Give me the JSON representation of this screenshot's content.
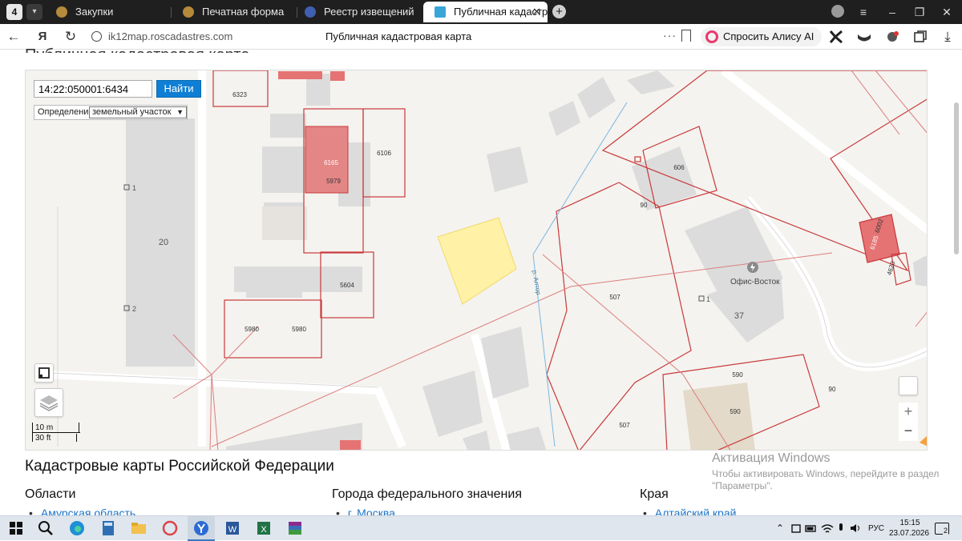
{
  "browser": {
    "tab_counter": "4",
    "tabs": [
      {
        "label": "Закупки"
      },
      {
        "label": "Печатная форма"
      },
      {
        "label": "Реестр извещений"
      },
      {
        "label": "Публичная кадастровая"
      }
    ],
    "address": {
      "url": "ik12map.roscadastres.com",
      "title": "Публичная кадастровая карта",
      "alice_label": "Спросить Алису AI"
    }
  },
  "map": {
    "search_value": "14:22:050001:6434",
    "find_label": "Найти",
    "definition_label": "Определение:",
    "definition_value": "земельный участок",
    "scale_metric": "10 m",
    "scale_imperial": "30 ft",
    "parcel_labels": [
      "6323",
      "6165",
      "5979",
      "6106",
      "606",
      "90",
      "5604",
      "5980",
      "5980",
      "507",
      "507",
      "590",
      "590",
      "90",
      "6002",
      "6185",
      "4620"
    ],
    "building_labels": [
      "20",
      "37"
    ],
    "entrance_labels": [
      "1",
      "2",
      "1"
    ],
    "poi_label": "Офис-Восток",
    "street_label": "р. Алтор",
    "colors": {
      "parcel_line": "#d04b4b",
      "parcel_fill": "#e57373",
      "highlight": "#fff2a6",
      "building": "#dcdcdc"
    }
  },
  "content": {
    "section_title": "Кадастровые карты Российской Федерации",
    "columns": [
      {
        "title": "Области",
        "first_item": "Амурская область"
      },
      {
        "title": "Города федерального значения",
        "first_item": "г. Москва"
      },
      {
        "title": "Края",
        "first_item": "Алтайский край"
      }
    ],
    "windows_activation_title": "Активация Windows",
    "windows_activation_text": "Чтобы активировать Windows, перейдите в раздел \"Параметры\"."
  },
  "taskbar": {
    "language": "РУС",
    "time": "15:15",
    "date": "23.07.2026",
    "notifications": "2"
  }
}
